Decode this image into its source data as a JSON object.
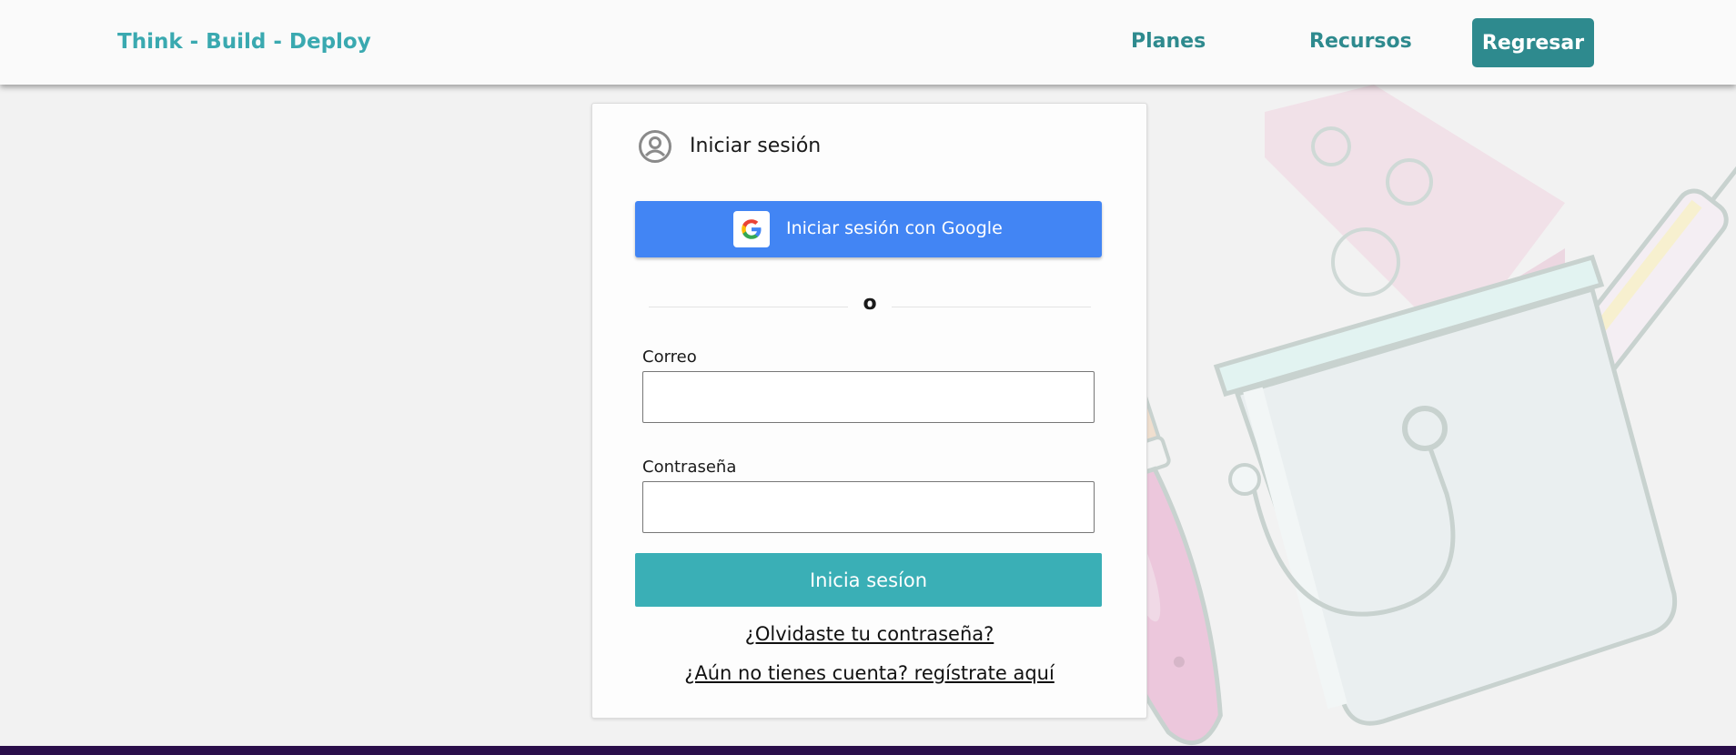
{
  "header": {
    "brand": "Think - Build - Deploy",
    "nav": {
      "planes": "Planes",
      "recursos": "Recursos"
    },
    "back_button": "Regresar"
  },
  "login": {
    "title": "Iniciar sesión",
    "google_button": "Iniciar sesión con Google",
    "divider": "o",
    "email_label": "Correo",
    "email_value": "",
    "password_label": "Contraseña",
    "password_value": "",
    "submit": "Inicia sesíon",
    "forgot_link": "¿Olvidaste tu contraseña?",
    "register_link": "¿Aún no tienes cuenta? regístrate aquí"
  },
  "icons": {
    "user": "user-circle-icon",
    "google": "google-logo-icon"
  },
  "colors": {
    "brand": "#3aa9b0",
    "nav": "#2e8a8e",
    "google": "#4285f4",
    "submit": "#3aafb6",
    "footer": "#2a0e4a"
  }
}
